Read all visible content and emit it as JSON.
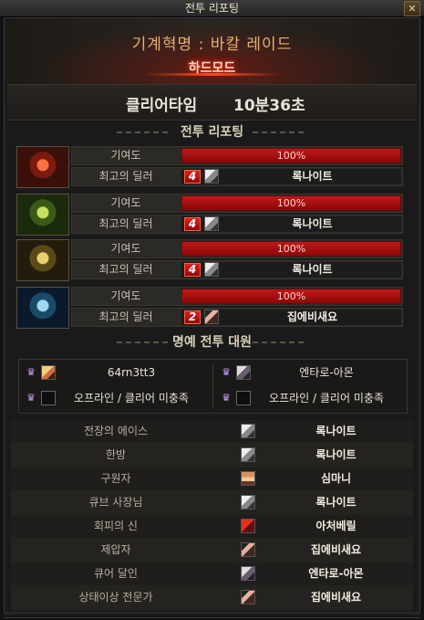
{
  "window": {
    "title": "전투 리포팅",
    "close_glyph": "✕"
  },
  "header": {
    "raid_name": "기계혁명 : 바칼 레이드",
    "mode": "하드모드"
  },
  "clear": {
    "label": "클리어타임",
    "time": "10분36초"
  },
  "sections": {
    "report": "전투 리포팅",
    "honor": "명예 전투 대원"
  },
  "combatants": [
    {
      "emblem_icon": "red-flame-helm-emblem-icon",
      "contribution_label": "기여도",
      "contribution": "100%",
      "contribution_value": 1.0,
      "best_dealer_label": "최고의 딜러",
      "badge": "4",
      "dealer": "록나이트"
    },
    {
      "emblem_icon": "green-helm-emblem-icon",
      "contribution_label": "기여도",
      "contribution": "100%",
      "contribution_value": 1.0,
      "best_dealer_label": "최고의 딜러",
      "badge": "4",
      "dealer": "록나이트"
    },
    {
      "emblem_icon": "gold-helm-emblem-icon",
      "contribution_label": "기여도",
      "contribution": "100%",
      "contribution_value": 1.0,
      "best_dealer_label": "최고의 딜러",
      "badge": "4",
      "dealer": "록나이트"
    },
    {
      "emblem_icon": "blue-helm-emblem-icon",
      "contribution_label": "기여도",
      "contribution": "100%",
      "contribution_value": 1.0,
      "best_dealer_label": "최고의 딜러",
      "badge": "2",
      "dealer": "집에비새요"
    }
  ],
  "honor_party": [
    {
      "name": "64rn3tt3",
      "icon": "crown-icon",
      "empty": false
    },
    {
      "name": "엔타로-아몬",
      "icon": "crown-icon",
      "empty": false
    },
    {
      "name": "오프라인 / 클리어 미충족",
      "icon": "crown-icon",
      "empty": true
    },
    {
      "name": "오프라인 / 클리어 미충족",
      "icon": "crown-icon",
      "empty": true
    }
  ],
  "awards": [
    {
      "title": "전장의 에이스",
      "name": "록나이트"
    },
    {
      "title": "한방",
      "name": "록나이트"
    },
    {
      "title": "구원자",
      "name": "심마니"
    },
    {
      "title": "큐브 사장님",
      "name": "록나이트"
    },
    {
      "title": "회피의 신",
      "name": "아처베릴"
    },
    {
      "title": "제압자",
      "name": "집에비새요"
    },
    {
      "title": "큐어 달인",
      "name": "엔타로-아몬"
    },
    {
      "title": "상태이상 전문가",
      "name": "집에비새요"
    }
  ],
  "colors": {
    "accent_red": "#c01818",
    "title_gold": "#e8b070",
    "badge_red": "#e02020"
  }
}
